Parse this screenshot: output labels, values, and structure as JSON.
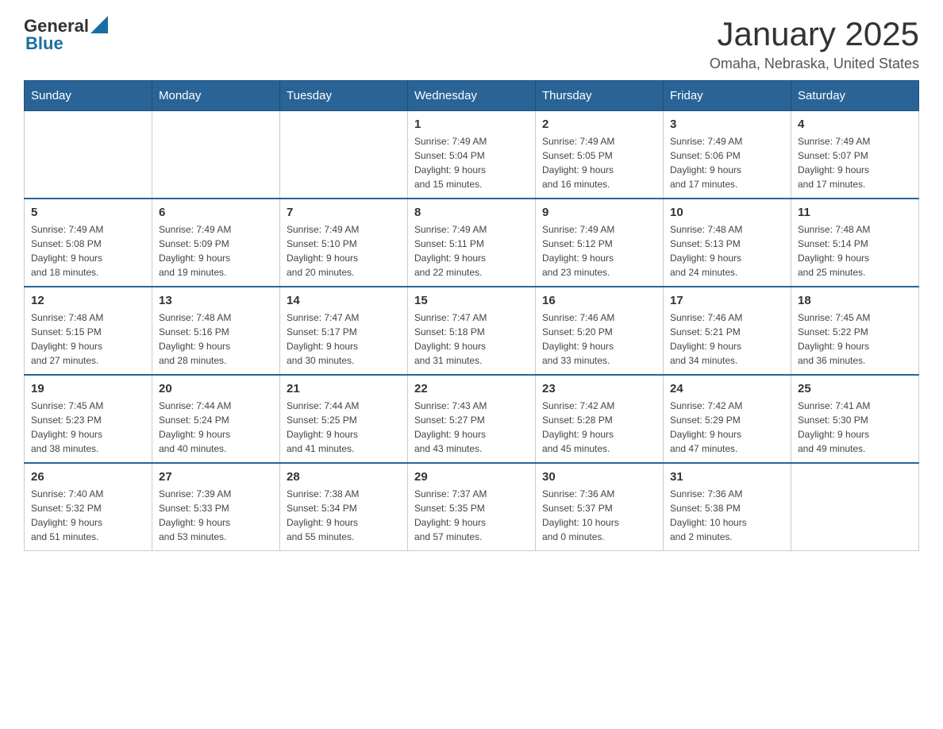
{
  "header": {
    "logo_general": "General",
    "logo_blue": "Blue",
    "month_title": "January 2025",
    "location": "Omaha, Nebraska, United States"
  },
  "weekdays": [
    "Sunday",
    "Monday",
    "Tuesday",
    "Wednesday",
    "Thursday",
    "Friday",
    "Saturday"
  ],
  "weeks": [
    [
      {
        "day": "",
        "info": ""
      },
      {
        "day": "",
        "info": ""
      },
      {
        "day": "",
        "info": ""
      },
      {
        "day": "1",
        "info": "Sunrise: 7:49 AM\nSunset: 5:04 PM\nDaylight: 9 hours\nand 15 minutes."
      },
      {
        "day": "2",
        "info": "Sunrise: 7:49 AM\nSunset: 5:05 PM\nDaylight: 9 hours\nand 16 minutes."
      },
      {
        "day": "3",
        "info": "Sunrise: 7:49 AM\nSunset: 5:06 PM\nDaylight: 9 hours\nand 17 minutes."
      },
      {
        "day": "4",
        "info": "Sunrise: 7:49 AM\nSunset: 5:07 PM\nDaylight: 9 hours\nand 17 minutes."
      }
    ],
    [
      {
        "day": "5",
        "info": "Sunrise: 7:49 AM\nSunset: 5:08 PM\nDaylight: 9 hours\nand 18 minutes."
      },
      {
        "day": "6",
        "info": "Sunrise: 7:49 AM\nSunset: 5:09 PM\nDaylight: 9 hours\nand 19 minutes."
      },
      {
        "day": "7",
        "info": "Sunrise: 7:49 AM\nSunset: 5:10 PM\nDaylight: 9 hours\nand 20 minutes."
      },
      {
        "day": "8",
        "info": "Sunrise: 7:49 AM\nSunset: 5:11 PM\nDaylight: 9 hours\nand 22 minutes."
      },
      {
        "day": "9",
        "info": "Sunrise: 7:49 AM\nSunset: 5:12 PM\nDaylight: 9 hours\nand 23 minutes."
      },
      {
        "day": "10",
        "info": "Sunrise: 7:48 AM\nSunset: 5:13 PM\nDaylight: 9 hours\nand 24 minutes."
      },
      {
        "day": "11",
        "info": "Sunrise: 7:48 AM\nSunset: 5:14 PM\nDaylight: 9 hours\nand 25 minutes."
      }
    ],
    [
      {
        "day": "12",
        "info": "Sunrise: 7:48 AM\nSunset: 5:15 PM\nDaylight: 9 hours\nand 27 minutes."
      },
      {
        "day": "13",
        "info": "Sunrise: 7:48 AM\nSunset: 5:16 PM\nDaylight: 9 hours\nand 28 minutes."
      },
      {
        "day": "14",
        "info": "Sunrise: 7:47 AM\nSunset: 5:17 PM\nDaylight: 9 hours\nand 30 minutes."
      },
      {
        "day": "15",
        "info": "Sunrise: 7:47 AM\nSunset: 5:18 PM\nDaylight: 9 hours\nand 31 minutes."
      },
      {
        "day": "16",
        "info": "Sunrise: 7:46 AM\nSunset: 5:20 PM\nDaylight: 9 hours\nand 33 minutes."
      },
      {
        "day": "17",
        "info": "Sunrise: 7:46 AM\nSunset: 5:21 PM\nDaylight: 9 hours\nand 34 minutes."
      },
      {
        "day": "18",
        "info": "Sunrise: 7:45 AM\nSunset: 5:22 PM\nDaylight: 9 hours\nand 36 minutes."
      }
    ],
    [
      {
        "day": "19",
        "info": "Sunrise: 7:45 AM\nSunset: 5:23 PM\nDaylight: 9 hours\nand 38 minutes."
      },
      {
        "day": "20",
        "info": "Sunrise: 7:44 AM\nSunset: 5:24 PM\nDaylight: 9 hours\nand 40 minutes."
      },
      {
        "day": "21",
        "info": "Sunrise: 7:44 AM\nSunset: 5:25 PM\nDaylight: 9 hours\nand 41 minutes."
      },
      {
        "day": "22",
        "info": "Sunrise: 7:43 AM\nSunset: 5:27 PM\nDaylight: 9 hours\nand 43 minutes."
      },
      {
        "day": "23",
        "info": "Sunrise: 7:42 AM\nSunset: 5:28 PM\nDaylight: 9 hours\nand 45 minutes."
      },
      {
        "day": "24",
        "info": "Sunrise: 7:42 AM\nSunset: 5:29 PM\nDaylight: 9 hours\nand 47 minutes."
      },
      {
        "day": "25",
        "info": "Sunrise: 7:41 AM\nSunset: 5:30 PM\nDaylight: 9 hours\nand 49 minutes."
      }
    ],
    [
      {
        "day": "26",
        "info": "Sunrise: 7:40 AM\nSunset: 5:32 PM\nDaylight: 9 hours\nand 51 minutes."
      },
      {
        "day": "27",
        "info": "Sunrise: 7:39 AM\nSunset: 5:33 PM\nDaylight: 9 hours\nand 53 minutes."
      },
      {
        "day": "28",
        "info": "Sunrise: 7:38 AM\nSunset: 5:34 PM\nDaylight: 9 hours\nand 55 minutes."
      },
      {
        "day": "29",
        "info": "Sunrise: 7:37 AM\nSunset: 5:35 PM\nDaylight: 9 hours\nand 57 minutes."
      },
      {
        "day": "30",
        "info": "Sunrise: 7:36 AM\nSunset: 5:37 PM\nDaylight: 10 hours\nand 0 minutes."
      },
      {
        "day": "31",
        "info": "Sunrise: 7:36 AM\nSunset: 5:38 PM\nDaylight: 10 hours\nand 2 minutes."
      },
      {
        "day": "",
        "info": ""
      }
    ]
  ]
}
